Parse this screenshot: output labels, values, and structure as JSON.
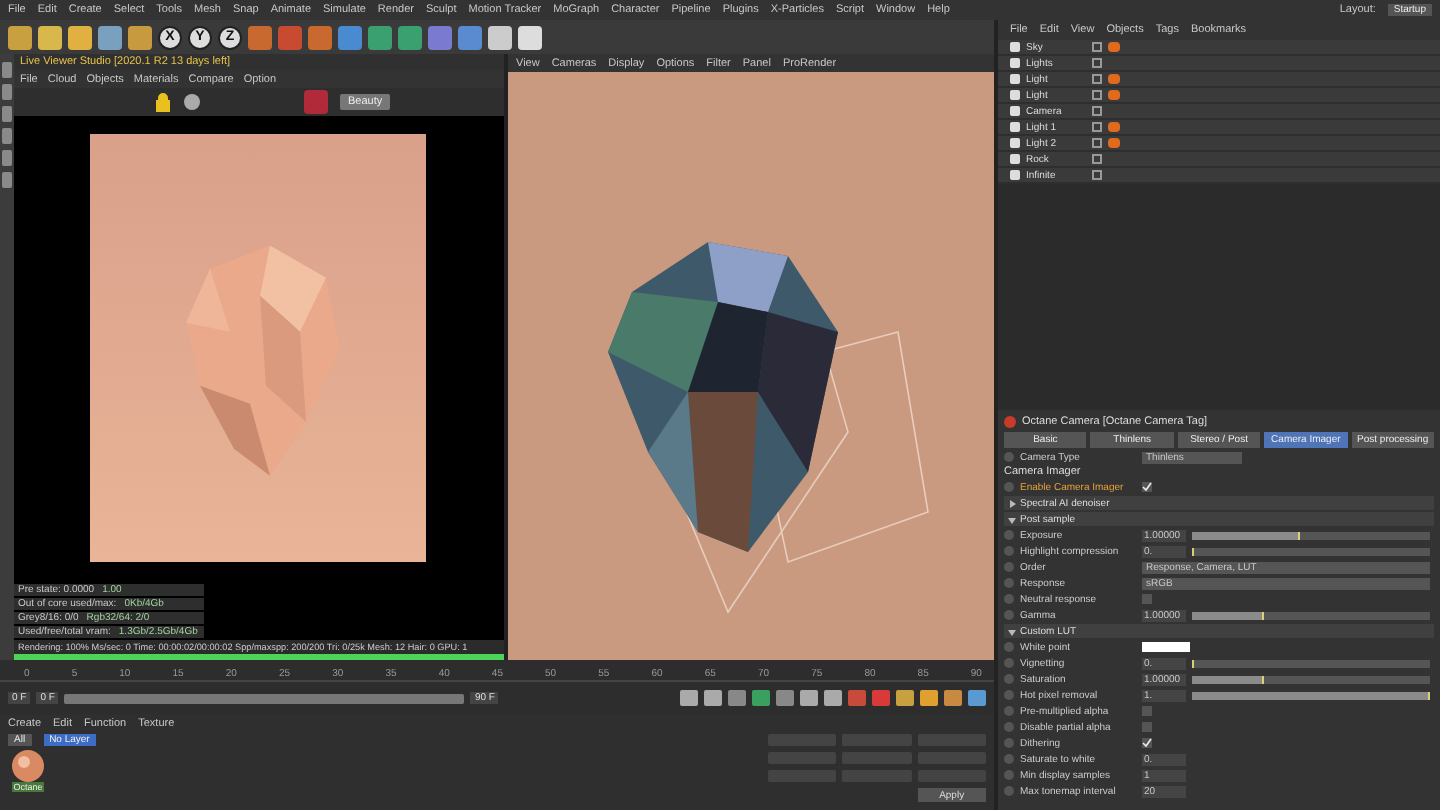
{
  "menu_bar": [
    "File",
    "Edit",
    "Create",
    "Select",
    "Tools",
    "Mesh",
    "Snap",
    "Animate",
    "Simulate",
    "Render",
    "Sculpt",
    "Motion Tracker",
    "MoGraph",
    "Character",
    "Pipeline",
    "Plugins",
    "X-Particles",
    "Script",
    "Window",
    "Help"
  ],
  "layout": {
    "label": "Layout:",
    "value": "Startup"
  },
  "toolbar_axes": [
    "X",
    "Y",
    "Z"
  ],
  "live_viewer": {
    "title": "Live Viewer Studio [2020.1 R2 13 days left]",
    "menu": [
      "File",
      "Cloud",
      "Objects",
      "Materials",
      "Compare",
      "Option"
    ],
    "channel": "Beauty",
    "stats": [
      {
        "label": "Pre state: 0.0000",
        "value": "1.00"
      },
      {
        "label": "Out of core used/max:",
        "value": "0Kb/4Gb"
      },
      {
        "label": "Grey8/16: 0/0",
        "value": "Rgb32/64: 2/0"
      },
      {
        "label": "Used/free/total vram:",
        "value": "1.3Gb/2.5Gb/4Gb"
      }
    ],
    "render_status": "Rendering: 100%  Ms/sec: 0  Time: 00:00:02/00:00:02  Spp/maxspp: 200/200  Tri: 0/25k  Mesh: 12  Hair: 0  GPU: 1",
    "progress": {
      "level": 1
    }
  },
  "viewport": {
    "menu": [
      "View",
      "Cameras",
      "Display",
      "Options",
      "Filter",
      "Panel",
      "ProRender"
    ]
  },
  "object_manager": {
    "menu": [
      "File",
      "Edit",
      "View",
      "Objects",
      "Tags",
      "Bookmarks"
    ],
    "objects": [
      {
        "name": "Sky",
        "tag": true
      },
      {
        "name": "Lights",
        "tag": false
      },
      {
        "name": "Light",
        "tag": true
      },
      {
        "name": "Light",
        "tag": true
      },
      {
        "name": "Camera",
        "tag": false
      },
      {
        "name": "Light 1",
        "tag": true
      },
      {
        "name": "Light 2",
        "tag": true
      },
      {
        "name": "Rock",
        "tag": false
      },
      {
        "name": "Infinite",
        "tag": false
      }
    ]
  },
  "attributes": {
    "title": "Octane Camera [Octane Camera Tag]",
    "tabs": [
      {
        "label": "Basic",
        "selected": false
      },
      {
        "label": "Thinlens",
        "selected": false
      },
      {
        "label": "Stereo / Post",
        "selected": false
      },
      {
        "label": "Camera Imager",
        "selected": true
      },
      {
        "label": "Post processing",
        "selected": false
      }
    ],
    "camera_type": {
      "label": "Camera Type",
      "value": "Thinlens"
    },
    "section": "Camera Imager",
    "rows": [
      {
        "kind": "check",
        "label": "Enable Camera Imager",
        "checked": true,
        "highlight": true
      },
      {
        "kind": "group",
        "label": "Spectral AI denoiser",
        "expanded": false
      },
      {
        "kind": "group",
        "label": "Post sample",
        "expanded": true
      },
      {
        "kind": "slider",
        "label": "Exposure",
        "value": "1.00000",
        "level": 0.45
      },
      {
        "kind": "slider",
        "label": "Highlight compression",
        "value": "0.",
        "level": 0
      },
      {
        "kind": "dropdown",
        "label": "Order",
        "value": "Response, Camera, LUT"
      },
      {
        "kind": "dropdown",
        "label": "Response",
        "value": "sRGB"
      },
      {
        "kind": "check",
        "label": "Neutral response",
        "checked": false,
        "highlight": false
      },
      {
        "kind": "slider",
        "label": "Gamma",
        "value": "1.00000",
        "level": 0.3
      },
      {
        "kind": "group",
        "label": "Custom LUT",
        "expanded": true
      },
      {
        "kind": "color",
        "label": "White point"
      },
      {
        "kind": "slider",
        "label": "Vignetting",
        "value": "0.",
        "level": 0
      },
      {
        "kind": "slider",
        "label": "Saturation",
        "value": "1.00000",
        "level": 0.3
      },
      {
        "kind": "slider",
        "label": "Hot pixel removal",
        "value": "1.",
        "level": 1
      },
      {
        "kind": "check",
        "label": "Pre-multiplied alpha",
        "checked": false,
        "highlight": false
      },
      {
        "kind": "check",
        "label": "Disable partial alpha",
        "checked": false,
        "highlight": false
      },
      {
        "kind": "check",
        "label": "Dithering",
        "checked": true,
        "highlight": false
      },
      {
        "kind": "number",
        "label": "Saturate to white",
        "value": "0."
      },
      {
        "kind": "number",
        "label": "Min display samples",
        "value": "1"
      },
      {
        "kind": "number",
        "label": "Max tonemap interval",
        "value": "20"
      }
    ]
  },
  "timeline": {
    "ticks": [
      "0",
      "5",
      "10",
      "15",
      "20",
      "25",
      "30",
      "35",
      "40",
      "45",
      "50",
      "55",
      "60",
      "65",
      "70",
      "75",
      "80",
      "85",
      "90"
    ],
    "start": "0 F",
    "end": "90 F",
    "current": "0 F",
    "range": {
      "level": 1
    }
  },
  "materials": {
    "menu": [
      "Create",
      "Edit",
      "Function",
      "Texture"
    ],
    "filters": [
      {
        "label": "All",
        "selected": false
      },
      {
        "label": "No Layer",
        "selected": true
      }
    ],
    "items": [
      {
        "name": "Octane"
      }
    ]
  },
  "coordinates": {
    "buttons": [
      "Apply"
    ]
  }
}
